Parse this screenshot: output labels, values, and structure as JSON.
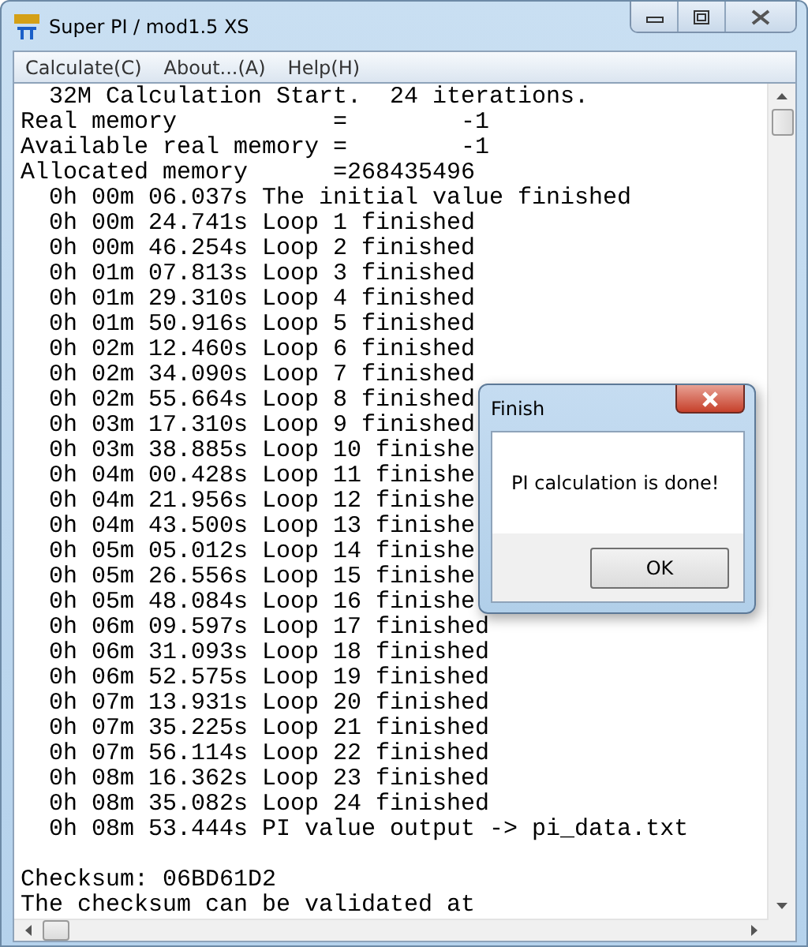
{
  "window": {
    "title": "Super PI / mod1.5 XS"
  },
  "menu": [
    "Calculate(C)",
    "About...(A)",
    "Help(H)"
  ],
  "output_lines": [
    {
      "kind": "text",
      "text": "  32M Calculation Start.  24 iterations."
    },
    {
      "kind": "text",
      "text": "Real memory           =        -1"
    },
    {
      "kind": "text",
      "text": "Available real memory =        -1"
    },
    {
      "kind": "text",
      "text": "Allocated memory      =268435496"
    },
    {
      "kind": "text",
      "text": "  0h 00m 06.037s The initial value finished"
    },
    {
      "kind": "text",
      "text": "  0h 00m 24.741s Loop 1 finished"
    },
    {
      "kind": "text",
      "text": "  0h 00m 46.254s Loop 2 finished"
    },
    {
      "kind": "text",
      "text": "  0h 01m 07.813s Loop 3 finished"
    },
    {
      "kind": "text",
      "text": "  0h 01m 29.310s Loop 4 finished"
    },
    {
      "kind": "text",
      "text": "  0h 01m 50.916s Loop 5 finished"
    },
    {
      "kind": "text",
      "text": "  0h 02m 12.460s Loop 6 finished"
    },
    {
      "kind": "text",
      "text": "  0h 02m 34.090s Loop 7 finished"
    },
    {
      "kind": "text",
      "text": "  0h 02m 55.664s Loop 8 finished"
    },
    {
      "kind": "text",
      "text": "  0h 03m 17.310s Loop 9 finished"
    },
    {
      "kind": "text",
      "text": "  0h 03m 38.885s Loop 10 finishe"
    },
    {
      "kind": "text",
      "text": "  0h 04m 00.428s Loop 11 finishe"
    },
    {
      "kind": "text",
      "text": "  0h 04m 21.956s Loop 12 finishe"
    },
    {
      "kind": "text",
      "text": "  0h 04m 43.500s Loop 13 finishe"
    },
    {
      "kind": "text",
      "text": "  0h 05m 05.012s Loop 14 finishe"
    },
    {
      "kind": "text",
      "text": "  0h 05m 26.556s Loop 15 finishe"
    },
    {
      "kind": "text",
      "text": "  0h 05m 48.084s Loop 16 finishe"
    },
    {
      "kind": "text",
      "text": "  0h 06m 09.597s Loop 17 finished"
    },
    {
      "kind": "text",
      "text": "  0h 06m 31.093s Loop 18 finished"
    },
    {
      "kind": "text",
      "text": "  0h 06m 52.575s Loop 19 finished"
    },
    {
      "kind": "text",
      "text": "  0h 07m 13.931s Loop 20 finished"
    },
    {
      "kind": "text",
      "text": "  0h 07m 35.225s Loop 21 finished"
    },
    {
      "kind": "text",
      "text": "  0h 07m 56.114s Loop 22 finished"
    },
    {
      "kind": "text",
      "text": "  0h 08m 16.362s Loop 23 finished"
    },
    {
      "kind": "text",
      "text": "  0h 08m 35.082s Loop 24 finished"
    },
    {
      "kind": "text",
      "text": "  0h 08m 53.444s PI value output -> pi_data.txt"
    },
    {
      "kind": "blank"
    },
    {
      "kind": "text",
      "text": "Checksum: 06BD61D2"
    },
    {
      "kind": "text",
      "text": "The checksum can be validated at"
    }
  ],
  "dialog": {
    "title": "Finish",
    "message": "PI calculation is done!",
    "buttons": [
      "OK"
    ]
  }
}
